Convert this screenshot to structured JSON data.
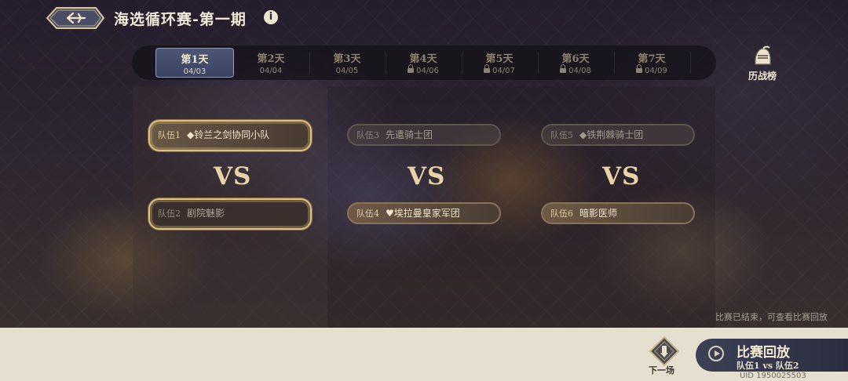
{
  "header": {
    "title": "海选循环赛-第一期",
    "info_icon": "i"
  },
  "tabs": [
    {
      "day": "第1天",
      "date": "04/03",
      "active": true,
      "locked": false
    },
    {
      "day": "第2天",
      "date": "04/04",
      "active": false,
      "locked": false
    },
    {
      "day": "第3天",
      "date": "04/05",
      "active": false,
      "locked": false
    },
    {
      "day": "第4天",
      "date": "04/06",
      "active": false,
      "locked": true
    },
    {
      "day": "第5天",
      "date": "04/07",
      "active": false,
      "locked": true
    },
    {
      "day": "第6天",
      "date": "04/08",
      "active": false,
      "locked": true
    },
    {
      "day": "第7天",
      "date": "04/09",
      "active": false,
      "locked": true
    }
  ],
  "history": {
    "label": "历战榜"
  },
  "matches": [
    {
      "team_a": {
        "num": "队伍1",
        "name": "◆铃兰之剑协同小队"
      },
      "vs": "VS",
      "team_b": {
        "num": "队伍2",
        "name": "剧院魅影"
      }
    },
    {
      "team_a": {
        "num": "队伍3",
        "name": "先遣骑士团"
      },
      "vs": "VS",
      "team_b": {
        "num": "队伍4",
        "name": "♥埃拉曼皇家军团"
      }
    },
    {
      "team_a": {
        "num": "队伍5",
        "name": "◆铁荆棘骑士团"
      },
      "vs": "VS",
      "team_b": {
        "num": "队伍6",
        "name": "暗影医师"
      }
    }
  ],
  "status": {
    "ended_text": "比赛已结束，可查看比赛回放"
  },
  "next": {
    "label": "下一场"
  },
  "replay": {
    "title": "比赛回放",
    "subtitle": "队伍1 vs 队伍2"
  },
  "uid": "UID 1950025503",
  "colors": {
    "accent_gold": "#d9bf82",
    "active_tab": "#4d5677",
    "replay_bg": "#3d4156"
  }
}
